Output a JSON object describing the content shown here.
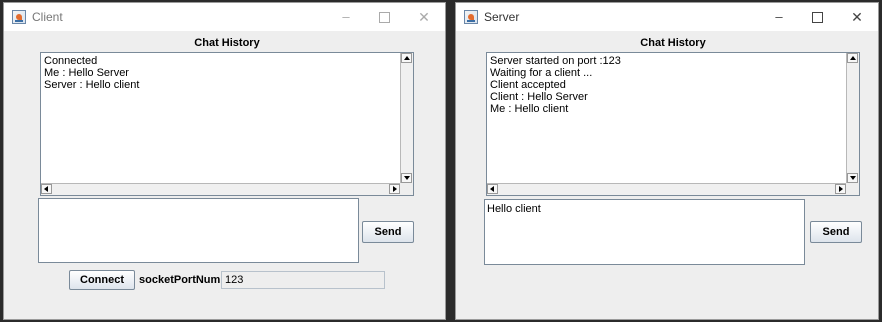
{
  "client": {
    "window_title": "Client",
    "heading": "Chat History",
    "history": [
      "Connected",
      "Me : Hello Server",
      "Server : Hello client"
    ],
    "message_value": "",
    "send_label": "Send",
    "connect_label": "Connect",
    "port_label": "socketPortNum :",
    "port_value": "123"
  },
  "server": {
    "window_title": "Server",
    "heading": "Chat History",
    "history": [
      "Server started on port :123",
      "Waiting for a client ...",
      "Client accepted",
      "Client : Hello Server",
      "Me : Hello client"
    ],
    "message_value": "Hello client",
    "send_label": "Send"
  },
  "window_controls": {
    "minimize": "–",
    "close": "✕"
  },
  "icons": {
    "app": "java-app-icon",
    "scroll_up": "arrow-up-icon",
    "scroll_down": "arrow-down-icon",
    "scroll_left": "arrow-left-icon",
    "scroll_right": "arrow-right-icon"
  },
  "colors": {
    "window_bg": "#eeeeee",
    "titlebar_bg": "#ffffff",
    "desktop_bg": "#2b2b2b"
  }
}
